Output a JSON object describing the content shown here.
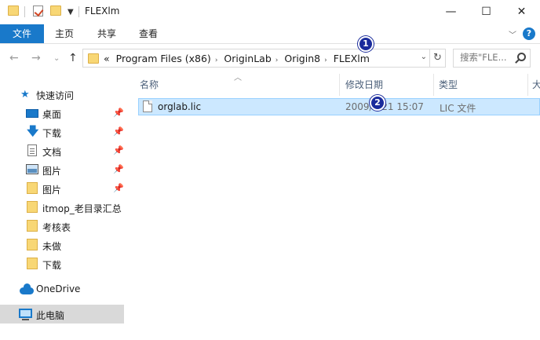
{
  "window": {
    "title": "FLEXlm",
    "minimize": "—",
    "maximize": "☐",
    "close": "✕"
  },
  "ribbon": {
    "tabs": [
      "文件",
      "主页",
      "共享",
      "查看"
    ],
    "help": "?"
  },
  "address": {
    "overflow": "«",
    "crumbs": [
      "Program Files (x86)",
      "OriginLab",
      "Origin8",
      "FLEXlm"
    ],
    "search_placeholder": "搜索\"FLE..."
  },
  "sidebar": {
    "quick_access": "快速访问",
    "items": [
      {
        "label": "桌面",
        "icon": "desktop-icon",
        "pinned": true
      },
      {
        "label": "下载",
        "icon": "download-icon",
        "pinned": true
      },
      {
        "label": "文档",
        "icon": "document-icon",
        "pinned": true
      },
      {
        "label": "图片",
        "icon": "pictures-icon",
        "pinned": true
      },
      {
        "label": "图片",
        "icon": "folder-icon",
        "pinned": true
      },
      {
        "label": "itmop_老目录汇总",
        "icon": "folder-icon",
        "pinned": false
      },
      {
        "label": "考核表",
        "icon": "folder-icon",
        "pinned": false
      },
      {
        "label": "未做",
        "icon": "folder-icon",
        "pinned": false
      },
      {
        "label": "下载",
        "icon": "folder-icon",
        "pinned": false
      }
    ],
    "onedrive": "OneDrive",
    "this_pc": "此电脑"
  },
  "columns": {
    "name": "名称",
    "date": "修改日期",
    "type": "类型",
    "size": "大"
  },
  "files": [
    {
      "name": "orglab.lic",
      "date": "2009/7/21 15:07",
      "type": "LIC 文件"
    }
  ],
  "annotations": {
    "badge1": "1",
    "badge2": "2"
  },
  "colors": {
    "accent": "#1979ca",
    "selection": "#cce8ff",
    "badge": "#1a2b9c"
  }
}
